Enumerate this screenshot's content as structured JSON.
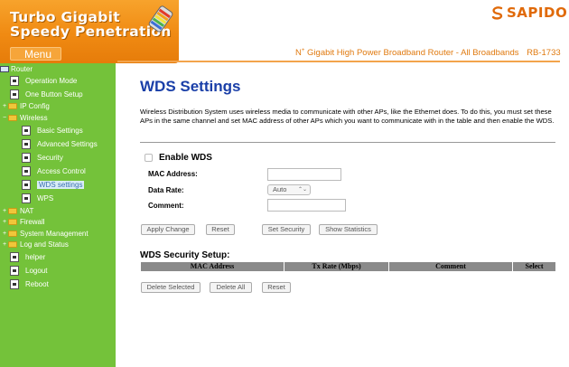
{
  "header": {
    "brand_line1": "Turbo Gigabit",
    "brand_line2": "Speedy Penetration",
    "menu_tab": "Menu",
    "logo_text": "SAPIDO",
    "subtitle_prefix": "N",
    "subtitle_sup": "+",
    "subtitle_main": "Gigabit High Power Broadband Router - All Broadbands",
    "model": "RB-1733",
    "colors": {
      "orange": "#f08a12",
      "accent_text": "#e07a10"
    }
  },
  "sidebar": {
    "bg_color": "#74c23a",
    "root": "Router",
    "items": [
      {
        "label": "Operation Mode",
        "type": "page"
      },
      {
        "label": "One Button Setup",
        "type": "page"
      },
      {
        "label": "IP Config",
        "type": "folder"
      },
      {
        "label": "Wireless",
        "type": "folder-open"
      },
      {
        "label": "Basic Settings",
        "type": "page"
      },
      {
        "label": "Advanced Settings",
        "type": "page"
      },
      {
        "label": "Security",
        "type": "page"
      },
      {
        "label": "Access Control",
        "type": "page"
      },
      {
        "label": "WDS settings",
        "type": "page",
        "selected": true
      },
      {
        "label": "WPS",
        "type": "page"
      },
      {
        "label": "NAT",
        "type": "folder"
      },
      {
        "label": "Firewall",
        "type": "folder"
      },
      {
        "label": "System Management",
        "type": "folder"
      },
      {
        "label": "Log and Status",
        "type": "folder"
      },
      {
        "label": "helper",
        "type": "page"
      },
      {
        "label": "Logout",
        "type": "page"
      },
      {
        "label": "Reboot",
        "type": "page"
      }
    ]
  },
  "main": {
    "title": "WDS Settings",
    "description": "Wireless Distribution System uses wireless media to communicate with other APs, like the Ethernet does. To do this, you must set these APs in the same channel and set MAC address of other APs which you want to communicate with in the table and then enable the WDS.",
    "enable_label": "Enable WDS",
    "enable_checked": false,
    "mac_label": "MAC Address:",
    "mac_value": "",
    "rate_label": "Data Rate:",
    "rate_value": "Auto",
    "comment_label": "Comment:",
    "comment_value": "",
    "buttons": {
      "apply": "Apply Change",
      "reset": "Reset",
      "set_security": "Set Security",
      "show_statistics": "Show Statistics",
      "delete_selected": "Delete Selected",
      "delete_all": "Delete All",
      "reset2": "Reset"
    },
    "security_title": "WDS Security Setup:",
    "table_headers": [
      "MAC Address",
      "Tx Rate (Mbps)",
      "Comment",
      "Select"
    ]
  }
}
